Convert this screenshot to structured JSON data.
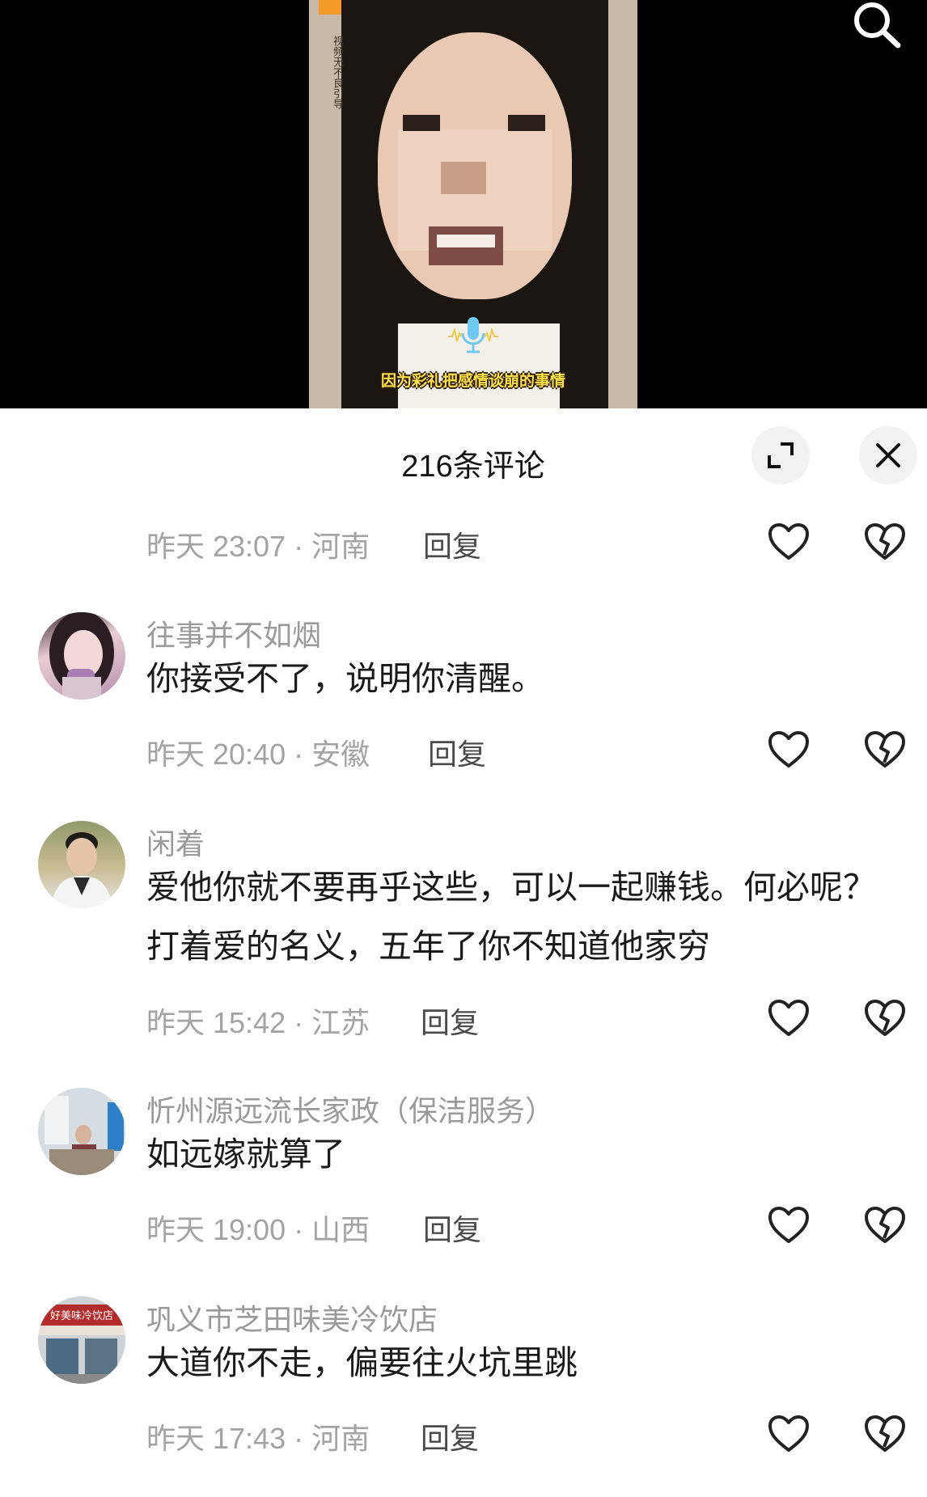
{
  "video": {
    "vertical_note": "视频无不良引导",
    "subtitle": "因为彩礼把感情谈崩的事情"
  },
  "comments_sheet": {
    "title": "216条评论",
    "comments": [
      {
        "time_location": "昨天 23:07 · 河南",
        "reply_label": "回复"
      },
      {
        "username": "往事并不如烟",
        "content": "你接受不了，说明你清醒。",
        "time_location": "昨天 20:40 · 安徽",
        "reply_label": "回复"
      },
      {
        "username": "闲着",
        "content": "爱他你就不要再乎这些，可以一起赚钱。何必呢？打着爱的名义，五年了你不知道他家穷",
        "time_location": "昨天 15:42 · 江苏",
        "reply_label": "回复"
      },
      {
        "username": "忻州源远流长家政（保洁服务）",
        "content": "如远嫁就算了",
        "time_location": "昨天 19:00 · 山西",
        "reply_label": "回复"
      },
      {
        "username": "巩义市芝田味美冷饮店",
        "content": "大道你不走，偏要往火坑里跳",
        "time_location": "昨天 17:43 · 河南",
        "reply_label": "回复",
        "avatar_sign": "好美味冷饮店"
      }
    ]
  },
  "icons": {
    "search": "search-icon",
    "expand": "expand-icon",
    "close": "close-icon",
    "like": "heart-icon",
    "dislike": "broken-heart-icon",
    "mic": "microphone-icon"
  },
  "colors": {
    "subtitle": "#ffe24a",
    "meta_text": "#a3a3a3",
    "username": "#9a9a9a",
    "accent_orange": "#f39a2a"
  }
}
